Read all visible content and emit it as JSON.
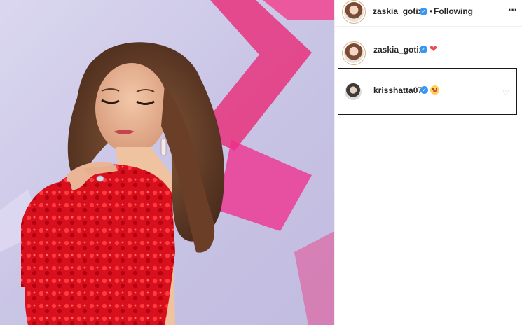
{
  "post": {
    "author": "zaskia_gotix",
    "follow_state": "Following",
    "separator": "•",
    "more_icon": "more-horizontal-icon"
  },
  "caption": {
    "author": "zaskia_gotix",
    "emoji": "❤"
  },
  "comments": [
    {
      "author": "krisshatta07",
      "emoji": "grinning-face-emoji",
      "like_icon": "heart-outline-icon"
    }
  ],
  "colors": {
    "verified_blue": "#3897f0",
    "heart_red": "#ed4956",
    "text": "#262626",
    "dress_red": "#d8101e",
    "background_lilac": "#c9c4e6",
    "stage_pink": "#e8327e"
  }
}
